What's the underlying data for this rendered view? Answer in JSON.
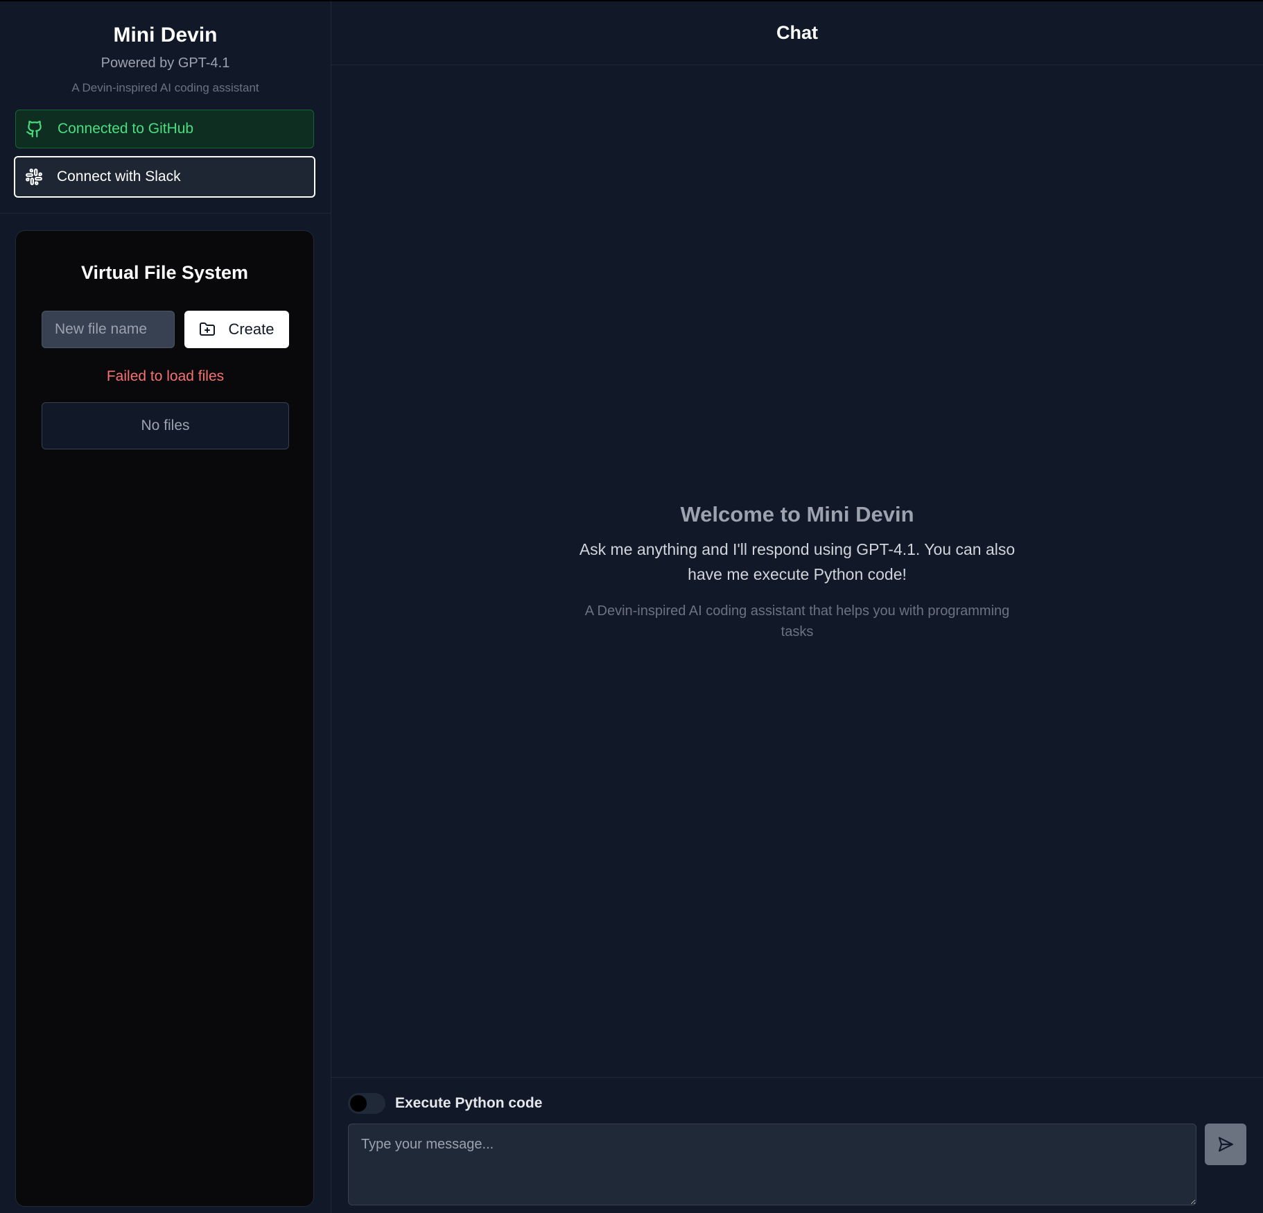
{
  "sidebar": {
    "brand_title": "Mini Devin",
    "brand_subtitle": "Powered by GPT-4.1",
    "brand_description": "A Devin-inspired AI coding assistant",
    "github_label": "Connected to GitHub",
    "slack_label": "Connect with Slack",
    "github_icon": "github-icon",
    "slack_icon": "slack-icon"
  },
  "vfs": {
    "title": "Virtual File System",
    "new_file_placeholder": "New file name",
    "create_label": "Create",
    "error_text": "Failed to load files",
    "empty_text": "No files"
  },
  "chat": {
    "header_title": "Chat",
    "welcome_title": "Welcome to Mini Devin",
    "welcome_text": "Ask me anything and I'll respond using GPT-4.1. You can also have me execute Python code!",
    "welcome_description": "A Devin-inspired AI coding assistant that helps you with programming tasks",
    "execute_toggle_label": "Execute Python code",
    "execute_toggle_on": false,
    "message_placeholder": "Type your message..."
  },
  "colors": {
    "background": "#111827",
    "github_green": "#4ade80",
    "error_red": "#f87171",
    "panel_black": "#09090b"
  }
}
